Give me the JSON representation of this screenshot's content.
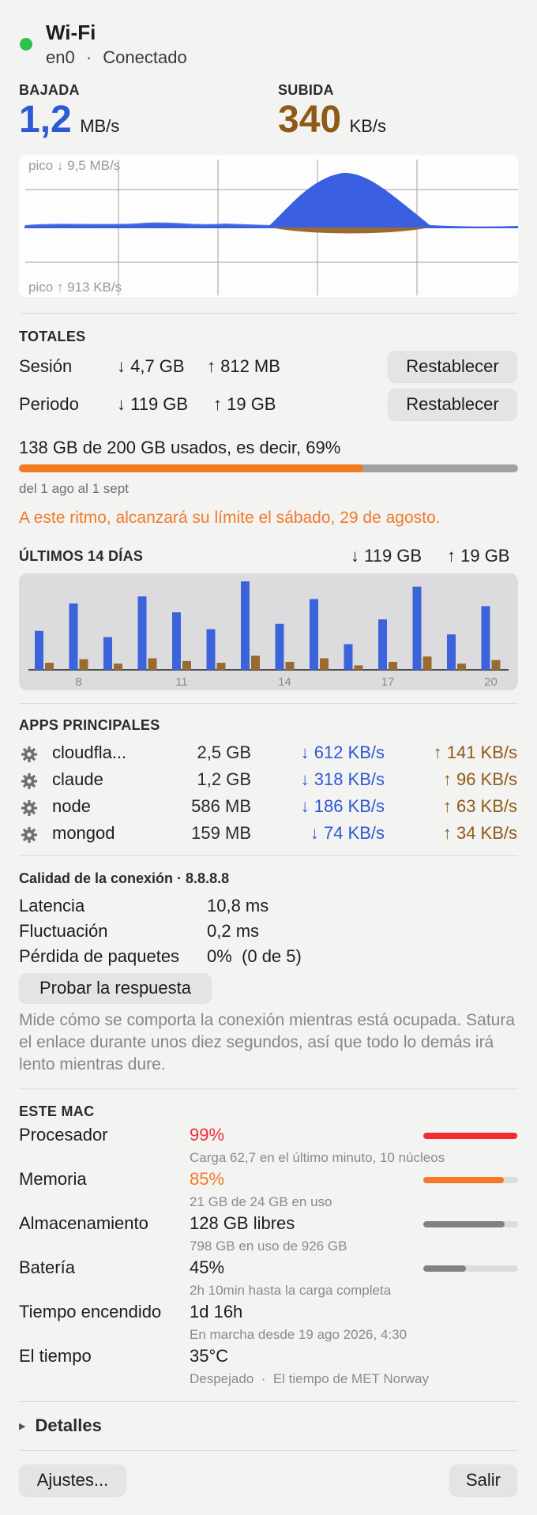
{
  "header": {
    "title": "Wi-Fi",
    "interface": "en0",
    "separator": "·",
    "status": "Conectado",
    "status_color": "#2fc24a"
  },
  "rates": {
    "down_label": "BAJADA",
    "down_value": "1,2",
    "down_unit": "MB/s",
    "up_label": "SUBIDA",
    "up_value": "340",
    "up_unit": "KB/s"
  },
  "graph": {
    "peak_down": "pico ↓ 9,5 MB/s",
    "peak_up": "pico ↑ 913 KB/s"
  },
  "totals": {
    "title": "TOTALES",
    "rows": [
      {
        "label": "Sesión",
        "down": "↓ 4,7 GB",
        "up": "↑ 812 MB",
        "button": "Restablecer"
      },
      {
        "label": "Periodo",
        "down": "↓ 119 GB",
        "up": "↑ 19 GB",
        "button": "Restablecer"
      }
    ],
    "usage_text": "138 GB de 200 GB usados, es decir, 69%",
    "usage_fraction": 0.69,
    "period": "del 1 ago al 1 sept",
    "warning": "A este ritmo, alcanzará su límite el sábado, 29 de agosto."
  },
  "last14": {
    "title": "ÚLTIMOS 14 DÍAS",
    "down_total": "↓ 119 GB",
    "up_total": "↑ 19 GB",
    "tick_labels": [
      "8",
      "11",
      "14",
      "17",
      "20"
    ]
  },
  "chart_data": {
    "type": "bar",
    "categories": [
      "7",
      "8",
      "9",
      "10",
      "11",
      "12",
      "13",
      "14",
      "15",
      "16",
      "17",
      "18",
      "19",
      "20"
    ],
    "series": [
      {
        "name": "down",
        "values": [
          4.4,
          7.5,
          3.7,
          8.3,
          6.5,
          4.6,
          10.0,
          5.2,
          8.0,
          2.9,
          5.7,
          9.4,
          4.0,
          7.2
        ]
      },
      {
        "name": "up",
        "values": [
          0.8,
          1.2,
          0.7,
          1.3,
          1.0,
          0.8,
          1.6,
          0.9,
          1.3,
          0.5,
          0.9,
          1.5,
          0.7,
          1.1
        ]
      }
    ],
    "colors": {
      "down": "#3c63db",
      "up": "#9a6b31"
    },
    "xlabel": "",
    "ylabel": ""
  },
  "apps": {
    "title": "APPS PRINCIPALES",
    "items": [
      {
        "name": "cloudfla...",
        "total": "2,5 GB",
        "down": "↓ 612 KB/s",
        "up": "↑ 141 KB/s",
        "icon": "gear-icon"
      },
      {
        "name": "claude",
        "total": "1,2 GB",
        "down": "↓ 318 KB/s",
        "up": "↑ 96 KB/s",
        "icon": "gear-icon"
      },
      {
        "name": "node",
        "total": "586 MB",
        "down": "↓ 186 KB/s",
        "up": "↑ 63 KB/s",
        "icon": "gear-icon"
      },
      {
        "name": "mongod",
        "total": "159 MB",
        "down": "↓ 74 KB/s",
        "up": "↑ 34 KB/s",
        "icon": "gear-icon"
      }
    ]
  },
  "quality": {
    "title": "Calidad de la conexión · 8.8.8.8",
    "rows": [
      {
        "label": "Latencia",
        "value": "10,8 ms"
      },
      {
        "label": "Fluctuación",
        "value": "0,2 ms"
      },
      {
        "label": "Pérdida de paquetes",
        "value": "0%  (0 de 5)"
      }
    ],
    "button": "Probar la respuesta",
    "description": "Mide cómo se comporta la conexión mientras está ocupada. Satura el enlace durante unos diez segundos, así que todo lo demás irá lento mientras dure."
  },
  "mac": {
    "title": "ESTE MAC",
    "rows": [
      {
        "label": "Procesador",
        "value": "99%",
        "sub": "Carga 62,7 en el último minuto, 10 núcleos",
        "level": 0.99,
        "color": "#f12a36"
      },
      {
        "label": "Memoria",
        "value": "85%",
        "sub": "21 GB de 24 GB en uso",
        "level": 0.85,
        "color": "#f2792a"
      },
      {
        "label": "Almacenamiento",
        "value": "128 GB libres",
        "sub": "798 GB en uso de 926 GB",
        "level": 0.86,
        "color": "#7f8184"
      },
      {
        "label": "Batería",
        "value": "45%",
        "sub": "2h 10min hasta la carga completa",
        "level": 0.45,
        "color": "#7f8184"
      },
      {
        "label": "Tiempo encendido",
        "value": "1d 16h",
        "sub": "En marcha desde 19 ago 2026, 4:30"
      },
      {
        "label": "El tiempo",
        "value": "35°C",
        "sub": "Despejado  ·  El tiempo de MET Norway"
      }
    ]
  },
  "footer": {
    "details": "Detalles",
    "settings": "Ajustes...",
    "quit": "Salir"
  }
}
